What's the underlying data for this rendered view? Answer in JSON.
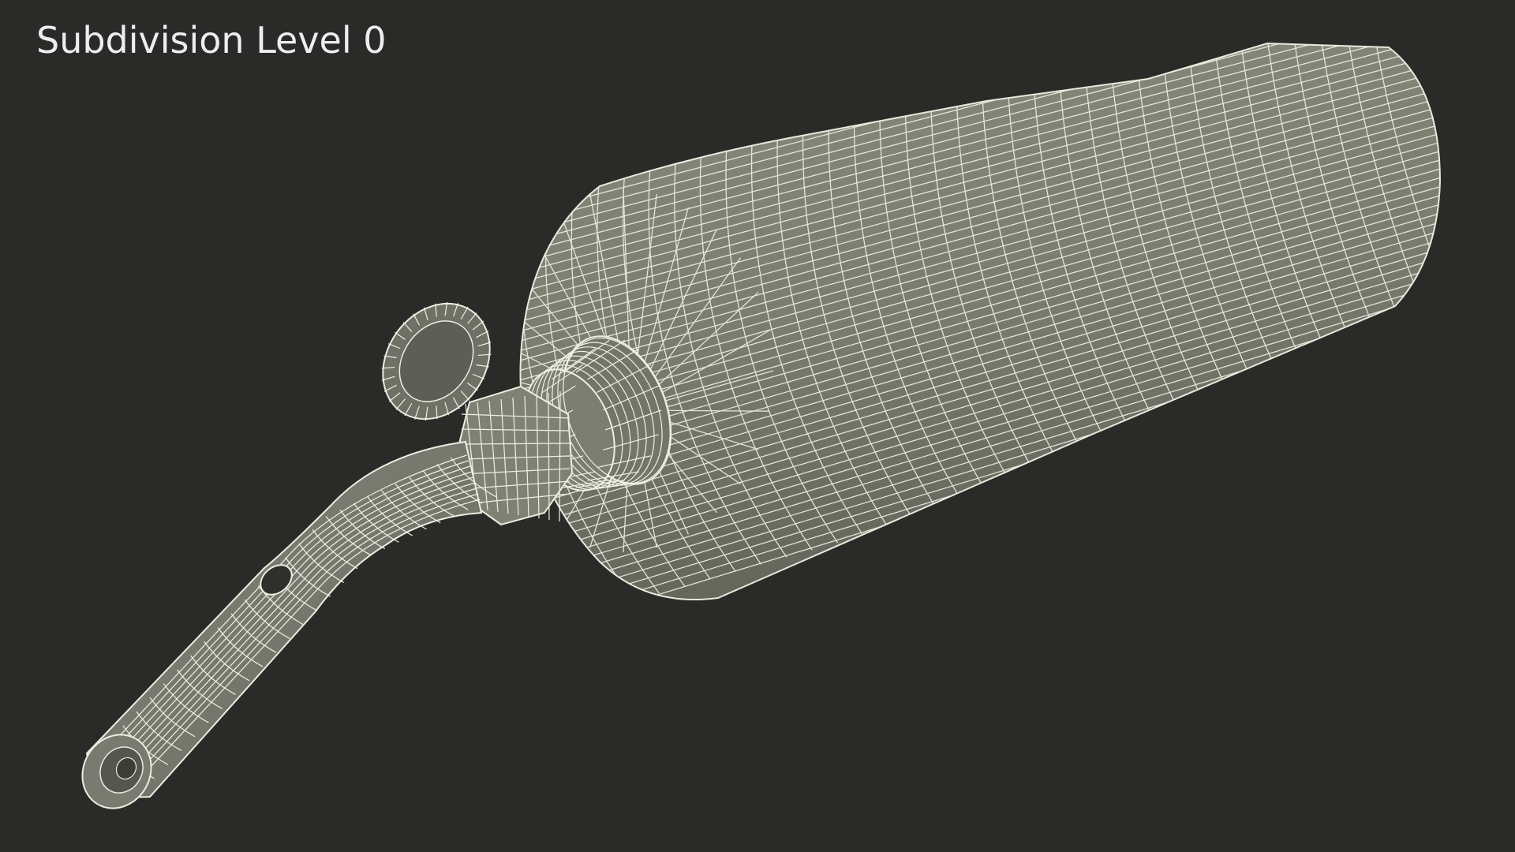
{
  "viewport": {
    "label": "Subdivision Level 0",
    "background_color": "#2a2a28"
  },
  "model": {
    "subject": "blowtorch-wireframe",
    "surface_color": "#7b7b70",
    "wire_color": "#f2f2e6"
  }
}
